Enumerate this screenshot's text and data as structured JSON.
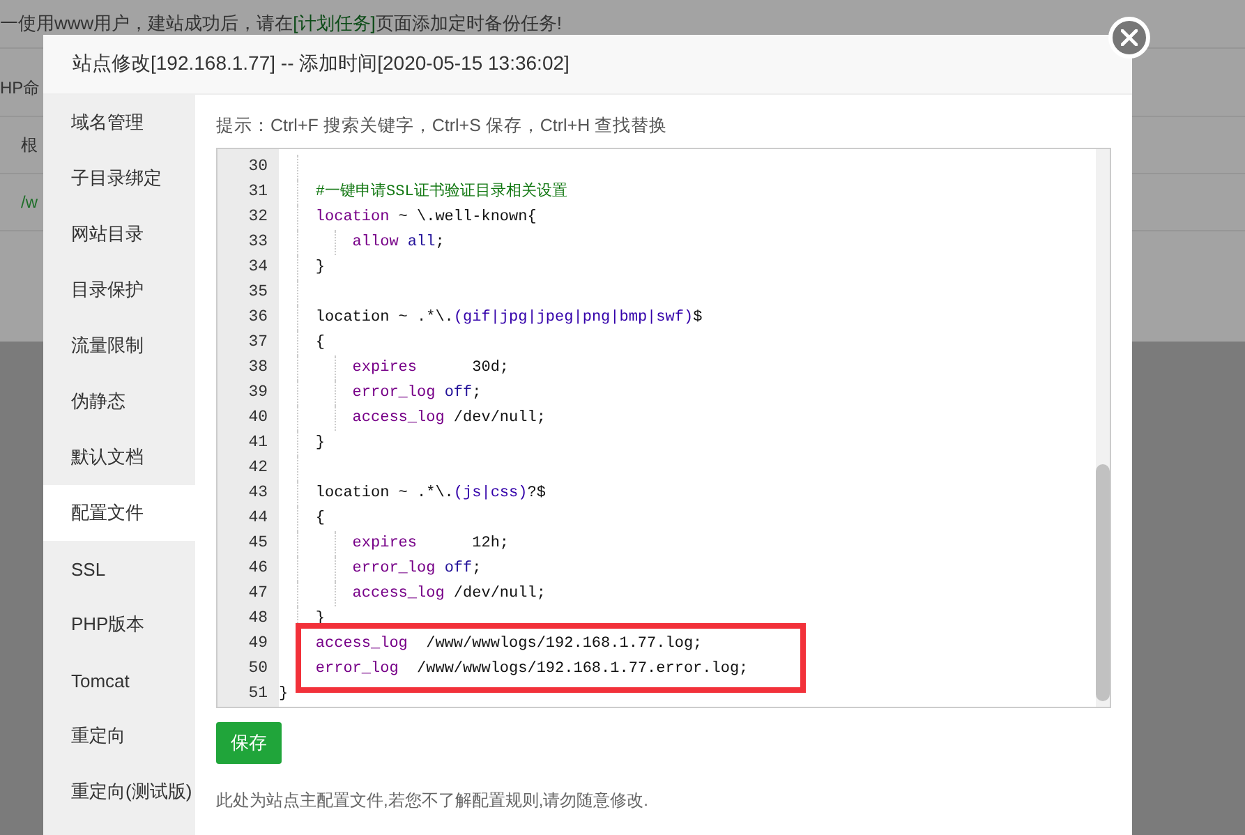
{
  "background": {
    "notice": {
      "before": "一使用www用户，建站成功后，请在",
      "link": "[计划任务]",
      "after": "页面添加定时备份任务!"
    },
    "fragments": [
      "HP命",
      "根",
      "/w"
    ]
  },
  "dialog": {
    "title": "站点修改[192.168.1.77] -- 添加时间[2020-05-15 13:36:02]",
    "sidebar": [
      {
        "label": "域名管理",
        "selected": false
      },
      {
        "label": "子目录绑定",
        "selected": false
      },
      {
        "label": "网站目录",
        "selected": false
      },
      {
        "label": "目录保护",
        "selected": false
      },
      {
        "label": "流量限制",
        "selected": false
      },
      {
        "label": "伪静态",
        "selected": false
      },
      {
        "label": "默认文档",
        "selected": false
      },
      {
        "label": "配置文件",
        "selected": true
      },
      {
        "label": "SSL",
        "selected": false
      },
      {
        "label": "PHP版本",
        "selected": false
      },
      {
        "label": "Tomcat",
        "selected": false
      },
      {
        "label": "重定向",
        "selected": false
      },
      {
        "label": "重定向(测试版)",
        "selected": false
      }
    ],
    "hint": "提示：Ctrl+F 搜索关键字，Ctrl+S 保存，Ctrl+H 查找替换",
    "code": {
      "block": {
        "children": [
          {
            "number": "30",
            "highlighted": false
          },
          {
            "number": "31",
            "highlighted": false,
            "tokens": [
              {
                "kind": "comment",
                "text": "#一键申请SSL证书验证目录相关设置"
              }
            ]
          },
          {
            "number": "32",
            "highlighted": false,
            "tokens": [
              {
                "kind": "keyword",
                "text": "location"
              },
              {
                "kind": "plain",
                "text": " ~ \\.well-known{"
              }
            ],
            "children": [
              {
                "number": "33",
                "highlighted": false,
                "tokens": [
                  {
                    "kind": "keyword",
                    "text": "allow"
                  },
                  {
                    "kind": "atom",
                    "text": " all"
                  },
                  {
                    "kind": "plain",
                    "text": ";"
                  }
                ]
              }
            ]
          },
          {
            "number": "34",
            "highlighted": false,
            "tokens": [
              {
                "kind": "plain",
                "text": "}"
              }
            ]
          },
          {
            "number": "35",
            "highlighted": false
          },
          {
            "number": "36",
            "highlighted": false,
            "tokens": [
              {
                "kind": "plain",
                "text": "location ~ .*\\."
              },
              {
                "kind": "regex",
                "text": "(gif|jpg|jpeg|png|bmp|swf)"
              },
              {
                "kind": "plain",
                "text": "$"
              }
            ]
          },
          {
            "number": "37",
            "highlighted": false,
            "tokens": [
              {
                "kind": "plain",
                "text": "{"
              }
            ],
            "children": [
              {
                "number": "38",
                "highlighted": false,
                "tokens": [
                  {
                    "kind": "keyword",
                    "text": "expires"
                  },
                  {
                    "kind": "plain",
                    "text": "      30d;"
                  }
                ]
              },
              {
                "number": "39",
                "highlighted": false,
                "tokens": [
                  {
                    "kind": "keyword",
                    "text": "error_log"
                  },
                  {
                    "kind": "atom",
                    "text": " off"
                  },
                  {
                    "kind": "plain",
                    "text": ";"
                  }
                ]
              },
              {
                "number": "40",
                "highlighted": false,
                "tokens": [
                  {
                    "kind": "keyword",
                    "text": "access_log"
                  },
                  {
                    "kind": "plain",
                    "text": " /dev/null;"
                  }
                ]
              }
            ]
          },
          {
            "number": "41",
            "highlighted": false,
            "tokens": [
              {
                "kind": "plain",
                "text": "}"
              }
            ]
          },
          {
            "number": "42",
            "highlighted": false
          },
          {
            "number": "43",
            "highlighted": false,
            "tokens": [
              {
                "kind": "plain",
                "text": "location ~ .*\\."
              },
              {
                "kind": "regex",
                "text": "(js|css)"
              },
              {
                "kind": "plain",
                "text": "?$"
              }
            ]
          },
          {
            "number": "44",
            "highlighted": false,
            "tokens": [
              {
                "kind": "plain",
                "text": "{"
              }
            ],
            "children": [
              {
                "number": "45",
                "highlighted": false,
                "tokens": [
                  {
                    "kind": "keyword",
                    "text": "expires"
                  },
                  {
                    "kind": "plain",
                    "text": "      12h;"
                  }
                ]
              },
              {
                "number": "46",
                "highlighted": false,
                "tokens": [
                  {
                    "kind": "keyword",
                    "text": "error_log"
                  },
                  {
                    "kind": "atom",
                    "text": " off"
                  },
                  {
                    "kind": "plain",
                    "text": ";"
                  }
                ]
              },
              {
                "number": "47",
                "highlighted": false,
                "tokens": [
                  {
                    "kind": "keyword",
                    "text": "access_log"
                  },
                  {
                    "kind": "plain",
                    "text": " /dev/null;"
                  }
                ]
              }
            ]
          },
          {
            "number": "48",
            "highlighted": false,
            "tokens": [
              {
                "kind": "plain",
                "text": "}"
              }
            ]
          },
          {
            "number": "49",
            "highlighted": true,
            "tokens": [
              {
                "kind": "keyword",
                "text": "access_log"
              },
              {
                "kind": "plain",
                "text": "  /www/wwwlogs/192.168.1.77.log;"
              }
            ]
          },
          {
            "number": "50",
            "highlighted": true,
            "tokens": [
              {
                "kind": "keyword",
                "text": "error_log"
              },
              {
                "kind": "plain",
                "text": "  /www/wwwlogs/192.168.1.77.error.log;"
              }
            ]
          }
        ]
      },
      "closing": {
        "number": "51",
        "highlighted": false,
        "tokens": [
          {
            "kind": "plain",
            "text": "}"
          }
        ]
      }
    },
    "save_button": "保存",
    "note": "此处为站点主配置文件,若您不了解配置规则,请勿随意修改."
  }
}
